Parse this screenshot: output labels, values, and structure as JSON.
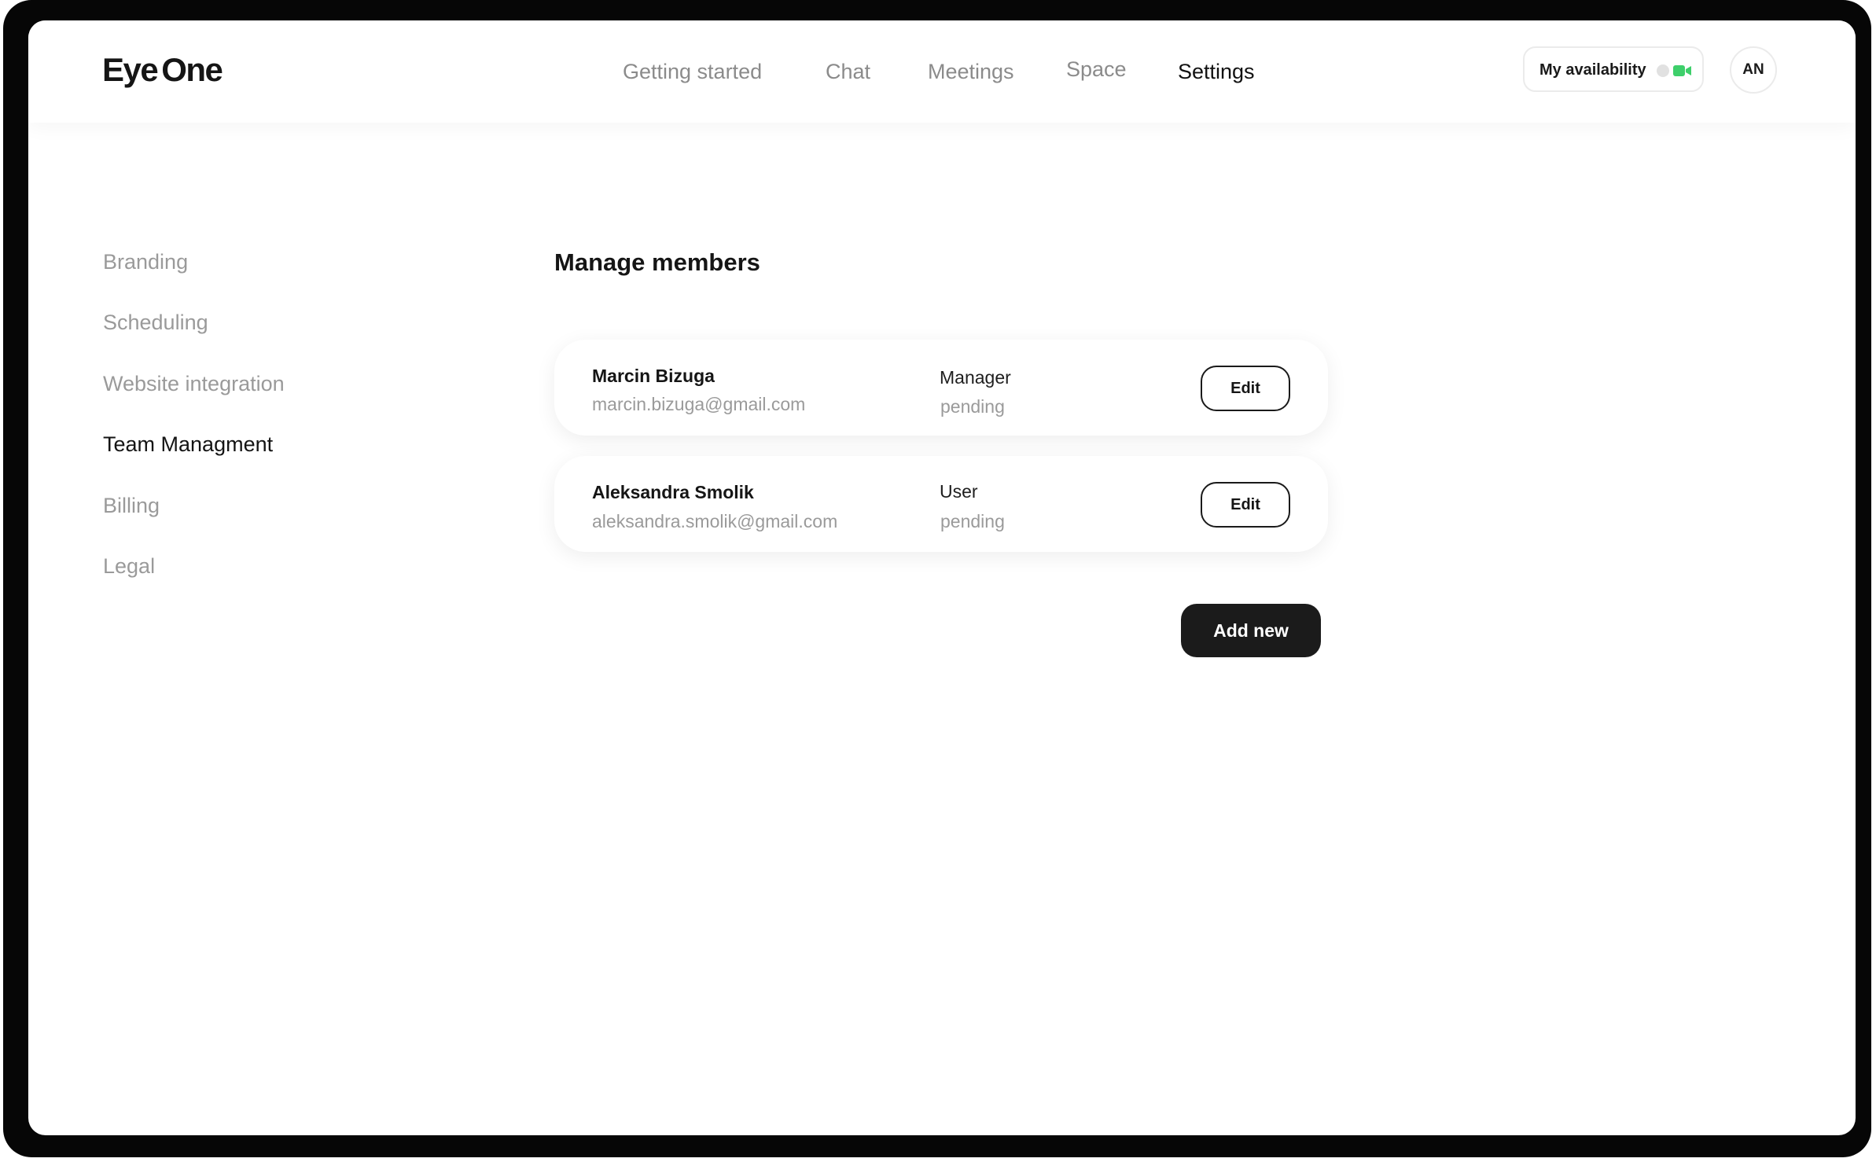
{
  "app": {
    "logo_word1": "Eye",
    "logo_word2": "One"
  },
  "nav": {
    "items": [
      {
        "label": "Getting started",
        "active": false
      },
      {
        "label": "Chat",
        "active": false
      },
      {
        "label": "Meetings",
        "active": false
      },
      {
        "label": "Space",
        "active": false
      },
      {
        "label": "Settings",
        "active": true
      }
    ]
  },
  "availability": {
    "label": "My availability",
    "icon": "video-camera-icon",
    "icon_color": "#3ecf6b"
  },
  "user": {
    "initials": "AN"
  },
  "sidebar": {
    "items": [
      {
        "label": "Branding",
        "active": false
      },
      {
        "label": "Scheduling",
        "active": false
      },
      {
        "label": "Website integration",
        "active": false
      },
      {
        "label": "Team Managment",
        "active": true
      },
      {
        "label": "Billing",
        "active": false
      },
      {
        "label": "Legal",
        "active": false
      }
    ]
  },
  "main": {
    "title": "Manage members",
    "members": [
      {
        "name": "Marcin Bizuga",
        "email": "marcin.bizuga@gmail.com",
        "role": "Manager",
        "status": "pending",
        "edit_label": "Edit"
      },
      {
        "name": "Aleksandra Smolik",
        "email": "aleksandra.smolik@gmail.com",
        "role": "User",
        "status": "pending",
        "edit_label": "Edit"
      }
    ],
    "add_label": "Add new"
  }
}
